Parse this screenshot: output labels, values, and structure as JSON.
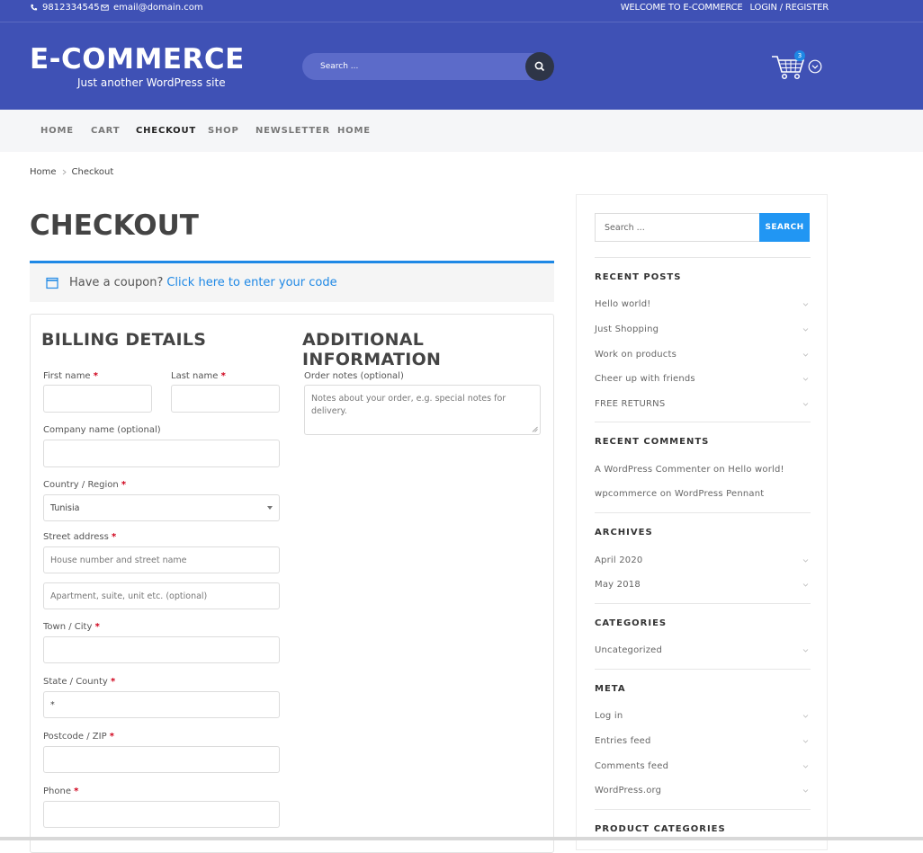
{
  "header": {
    "phone": "9812334545",
    "email": "email@domain.com",
    "welcome": "WELCOME TO E-COMMERCE",
    "login": "LOGIN / REGISTER",
    "site_title": "E-COMMERCE",
    "tagline": "Just another WordPress site",
    "search_placeholder": "Search ...",
    "cart_count": "3",
    "colors": {
      "brand": "#3f51b5",
      "accent": "#1e88e5"
    }
  },
  "nav": {
    "items": [
      {
        "label": "HOME"
      },
      {
        "label": "CART"
      },
      {
        "label": "CHECKOUT"
      },
      {
        "label": "SHOP"
      },
      {
        "label": "NEWSLETTER"
      },
      {
        "label": "HOME"
      }
    ],
    "active": "CHECKOUT"
  },
  "breadcrumb": {
    "home": "Home",
    "current": "Checkout"
  },
  "page": {
    "title": "CHECKOUT"
  },
  "coupon": {
    "text": "Have a coupon?",
    "link": "Click here to enter your code"
  },
  "billing": {
    "title": "BILLING DETAILS",
    "first_name": "First name",
    "last_name": "Last name",
    "company": "Company name (optional)",
    "country": "Country / Region",
    "country_value": "Tunisia",
    "street": "Street address",
    "street_placeholder_1": "House number and street name",
    "street_placeholder_2": "Apartment, suite, unit etc. (optional)",
    "town": "Town / City",
    "state": "State / County",
    "state_value": "*",
    "postcode": "Postcode / ZIP",
    "phone": "Phone",
    "required_mark": "*"
  },
  "additional": {
    "title": "ADDITIONAL INFORMATION",
    "notes_label": "Order notes (optional)",
    "notes_placeholder": "Notes about your order, e.g. special notes for delivery."
  },
  "sidebar": {
    "search_placeholder": "Search ...",
    "search_button": "SEARCH",
    "recent_posts": {
      "title": "RECENT POSTS",
      "items": [
        "Hello world!",
        "Just Shopping",
        "Work on products",
        "Cheer up with friends",
        "FREE RETURNS"
      ]
    },
    "recent_comments": {
      "title": "RECENT COMMENTS",
      "items": [
        "A WordPress Commenter on Hello world!",
        "wpcommerce on WordPress Pennant"
      ]
    },
    "archives": {
      "title": "ARCHIVES",
      "items": [
        "April 2020",
        "May 2018"
      ]
    },
    "categories": {
      "title": "CATEGORIES",
      "items": [
        "Uncategorized"
      ]
    },
    "meta": {
      "title": "META",
      "items": [
        "Log in",
        "Entries feed",
        "Comments feed",
        "WordPress.org"
      ]
    },
    "product_categories": {
      "title": "PRODUCT CATEGORIES"
    }
  }
}
